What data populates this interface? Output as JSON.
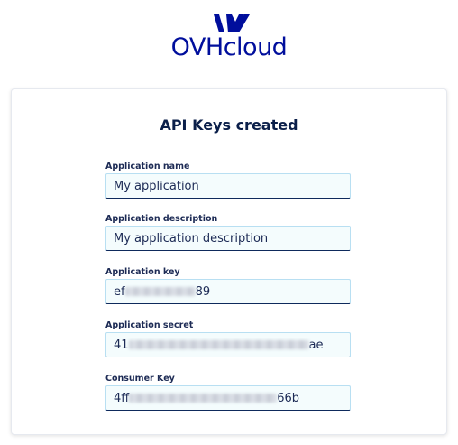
{
  "brand": {
    "name": "OVHcloud",
    "color": "#000e9c"
  },
  "card": {
    "title": "API Keys created"
  },
  "fields": [
    {
      "label": "Application name",
      "value": "My application"
    },
    {
      "label": "Application description",
      "value": "My application description"
    },
    {
      "label": "Application key",
      "prefix": "ef",
      "suffix": "89",
      "redacted": true
    },
    {
      "label": "Application secret",
      "prefix": "41",
      "suffix": "ae",
      "redacted": true
    },
    {
      "label": "Consumer Key",
      "prefix": "4ff",
      "suffix": "66b",
      "redacted": true
    }
  ],
  "icons": {
    "logo": "ovhcloud-logo-icon"
  }
}
